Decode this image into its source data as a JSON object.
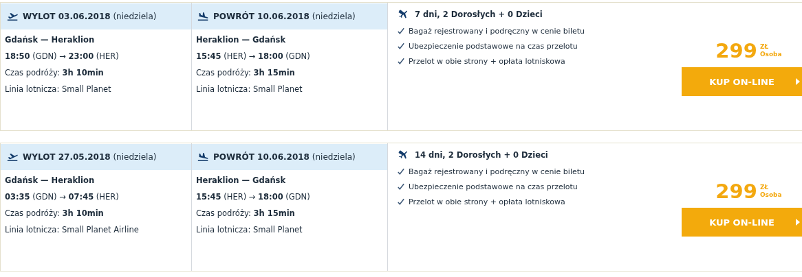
{
  "offers": [
    {
      "legs": [
        {
          "kind": "departure",
          "header": "**WYLOT 03.06.2018** (niedziela)",
          "route": "Gdańsk — Heraklion",
          "times": "**18:50** (GDN) → **23:00** (HER)",
          "duration": "Czas podróży: **3h 10min**",
          "airline": "Linia lotnicza: Small Planet"
        },
        {
          "kind": "return",
          "header": "**POWRÓT 10.06.2018** (niedziela)",
          "route": "Heraklion — Gdańsk",
          "times": "**15:45** (HER) → **18:00** (GDN)",
          "duration": "Czas podróży: **3h 15min**",
          "airline": "Linia lotnicza: Small Planet"
        }
      ],
      "summary": "7 dni, 2 Dorosłych + 0 Dzieci",
      "features": [
        "Bagaż rejestrowany i podręczny w cenie biletu",
        "Ubezpieczenie podstawowe na czas przelotu",
        "Przelot w obie strony + opłata lotniskowa"
      ],
      "price": "299",
      "currency": "ZŁ",
      "per": "Osoba",
      "button": "KUP ON-LINE"
    },
    {
      "legs": [
        {
          "kind": "departure",
          "header": "**WYLOT 27.05.2018** (niedziela)",
          "route": "Gdańsk — Heraklion",
          "times": "**03:35** (GDN) → **07:45** (HER)",
          "duration": "Czas podróży: **3h 10min**",
          "airline": "Linia lotnicza: Small Planet Airline"
        },
        {
          "kind": "return",
          "header": "**POWRÓT 10.06.2018** (niedziela)",
          "route": "Heraklion — Gdańsk",
          "times": "**15:45** (HER) → **18:00** (GDN)",
          "duration": "Czas podróży: **3h 15min**",
          "airline": "Linia lotnicza: Small Planet"
        }
      ],
      "summary": "14 dni, 2 Dorosłych + 0 Dzieci",
      "features": [
        "Bagaż rejestrowany i podręczny w cenie biletu",
        "Ubezpieczenie podstawowe na czas przelotu",
        "Przelot w obie strony + opłata lotniskowa"
      ],
      "price": "299",
      "currency": "ZŁ",
      "per": "Osoba",
      "button": "KUP ON-LINE"
    }
  ]
}
